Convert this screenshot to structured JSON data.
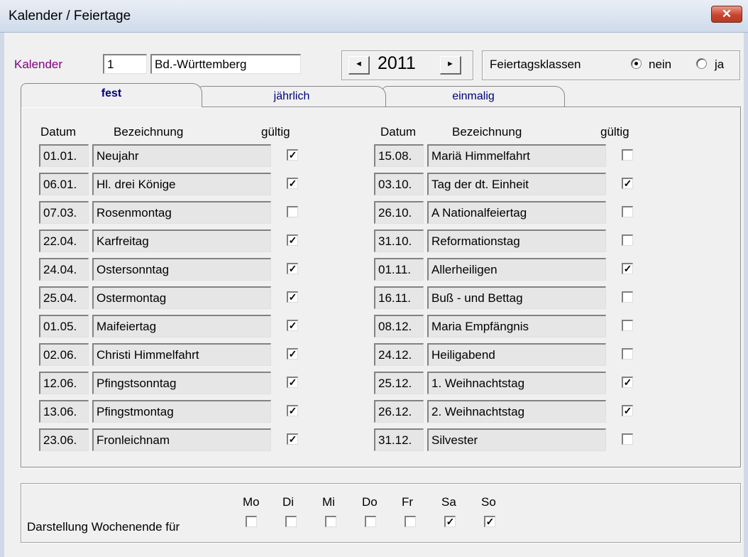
{
  "window": {
    "title": "Kalender / Feiertage",
    "close_icon": "✕"
  },
  "calendar": {
    "label": "Kalender",
    "number": "1",
    "name": "Bd.-Württemberg",
    "year": "2011",
    "prev_icon": "◄",
    "next_icon": "►"
  },
  "holiday_classes": {
    "label": "Feiertagsklassen",
    "option_nein": "nein",
    "option_ja": "ja",
    "selected": "nein"
  },
  "tabs": [
    "fest",
    "jährlich",
    "einmalig"
  ],
  "columns": {
    "datum": "Datum",
    "bezeichnung": "Bezeichnung",
    "gueltig": "gültig"
  },
  "holidays": [
    {
      "date": "01.01.",
      "name": "Neujahr",
      "valid": true
    },
    {
      "date": "06.01.",
      "name": "Hl. drei Könige",
      "valid": true
    },
    {
      "date": "07.03.",
      "name": "Rosenmontag",
      "valid": false
    },
    {
      "date": "22.04.",
      "name": "Karfreitag",
      "valid": true
    },
    {
      "date": "24.04.",
      "name": "Ostersonntag",
      "valid": true
    },
    {
      "date": "25.04.",
      "name": "Ostermontag",
      "valid": true
    },
    {
      "date": "01.05.",
      "name": "Maifeiertag",
      "valid": true
    },
    {
      "date": "02.06.",
      "name": "Christi Himmelfahrt",
      "valid": true
    },
    {
      "date": "12.06.",
      "name": "Pfingstsonntag",
      "valid": true
    },
    {
      "date": "13.06.",
      "name": "Pfingstmontag",
      "valid": true
    },
    {
      "date": "23.06.",
      "name": "Fronleichnam",
      "valid": true
    },
    {
      "date": "15.08.",
      "name": "Mariä Himmelfahrt",
      "valid": false
    },
    {
      "date": "03.10.",
      "name": "Tag der dt. Einheit",
      "valid": true
    },
    {
      "date": "26.10.",
      "name": "A  Nationalfeiertag",
      "valid": false
    },
    {
      "date": "31.10.",
      "name": "Reformationstag",
      "valid": false
    },
    {
      "date": "01.11.",
      "name": "Allerheiligen",
      "valid": true
    },
    {
      "date": "16.11.",
      "name": "Buß - und Bettag",
      "valid": false
    },
    {
      "date": "08.12.",
      "name": "Maria Empfängnis",
      "valid": false
    },
    {
      "date": "24.12.",
      "name": "Heiligabend",
      "valid": false
    },
    {
      "date": "25.12.",
      "name": "1. Weihnachtstag",
      "valid": true
    },
    {
      "date": "26.12.",
      "name": "2. Weihnachtstag",
      "valid": true
    },
    {
      "date": "31.12.",
      "name": "Silvester",
      "valid": false
    }
  ],
  "weekend": {
    "label": "Darstellung Wochenende für",
    "days": [
      {
        "label": "Mo",
        "checked": false
      },
      {
        "label": "Di",
        "checked": false
      },
      {
        "label": "Mi",
        "checked": false
      },
      {
        "label": "Do",
        "checked": false
      },
      {
        "label": "Fr",
        "checked": false
      },
      {
        "label": "Sa",
        "checked": true
      },
      {
        "label": "So",
        "checked": true
      }
    ]
  }
}
